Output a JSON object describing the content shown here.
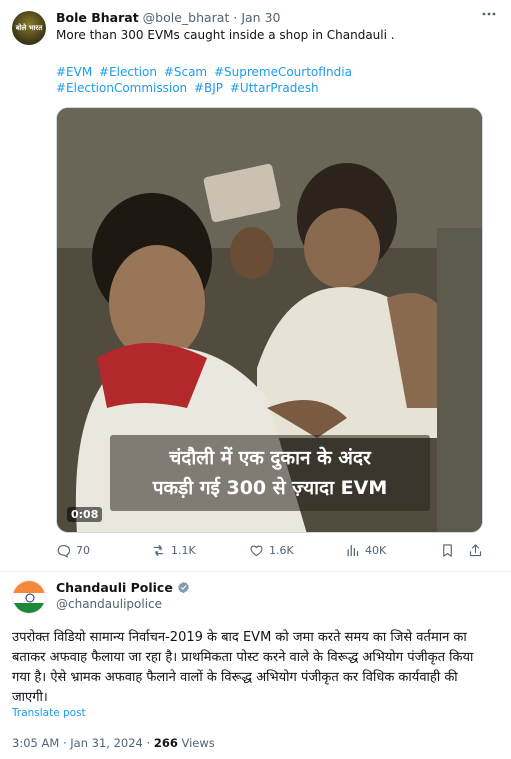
{
  "tweet1": {
    "author_name": "Bole Bharat",
    "author_handle": "@bole_bharat",
    "separator": "·",
    "date": "Jan 30",
    "avatar_logo_text": "बोले भारत",
    "more_icon": "ellipsis-icon",
    "text": "More than 300 EVMs caught inside a shop in Chandauli .",
    "hashtags": [
      "#EVM",
      "#Election",
      "#Scam",
      "#SupremeCourtofIndia",
      "#ElectionCommission",
      "#BJP",
      "#UttarPradesh"
    ],
    "video": {
      "caption_line1": "चंदौली में एक दुकान के अंदर",
      "caption_line2": "पकड़ी गई 300 से ज़्यादा EVM",
      "timecode": "0:08"
    },
    "actions": {
      "replies": "70",
      "reposts": "1.1K",
      "likes": "1.6K",
      "views": "40K"
    }
  },
  "tweet2": {
    "author_name": "Chandauli Police",
    "author_handle": "@chandaulipolice",
    "verified_badge_color": "#829aab",
    "body": "उपरोक्त विडियो सामान्य निर्वाचन-2019 के बाद EVM को जमा करते समय का जिसे वर्तमान का बताकर अफवाह फैलाया जा रहा है। प्राथमिकता पोस्ट करने वाले के विरूद्ध अभियोग पंजीकृत किया गया है। ऐसे भ्रामक अफवाह फैलाने वालों के विरूद्ध अभियोग पंजीकृत कर विधिक कार्यवाही की जाएगी।",
    "translate_label": "Translate post",
    "time": "3:05 AM",
    "separator": "·",
    "date": "Jan 31, 2024",
    "views_count": "266",
    "views_label": "Views"
  },
  "colors": {
    "link": "#1d9bf0",
    "muted": "#536471",
    "text": "#0f1419"
  }
}
